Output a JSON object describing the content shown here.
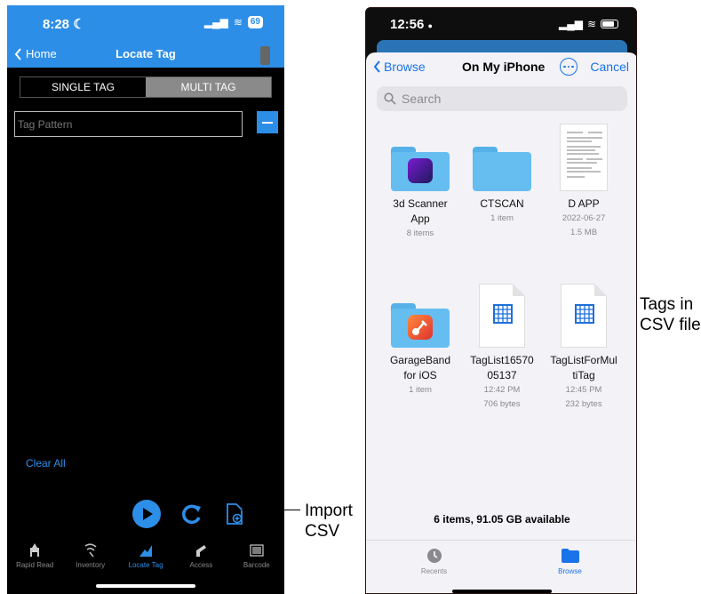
{
  "left_phone": {
    "status_bar": {
      "time": "8:28",
      "moon": "☾",
      "signal": "▂▄▆",
      "wifi": "≋",
      "battery": "69"
    },
    "nav": {
      "back_label": "Home",
      "title": "Locate Tag",
      "back_icon": "chevron-left-icon",
      "device_icon": "device-icon"
    },
    "segments": [
      {
        "label": "SINGLE TAG",
        "active": false
      },
      {
        "label": "MULTI TAG",
        "active": true
      }
    ],
    "tag_pattern_placeholder": "Tag Pattern",
    "clear_all": "Clear All",
    "actions": {
      "play_icon": "play-icon",
      "refresh_icon": "refresh-icon",
      "import_icon": "import-csv-icon"
    },
    "tabs": [
      {
        "label": "Rapid Read",
        "icon": "rapid-read-icon"
      },
      {
        "label": "Inventory",
        "icon": "inventory-icon"
      },
      {
        "label": "Locate Tag",
        "icon": "locate-tag-icon",
        "active": true
      },
      {
        "label": "Access",
        "icon": "access-icon"
      },
      {
        "label": "Barcode",
        "icon": "barcode-icon"
      }
    ]
  },
  "callouts": {
    "import_csv_line1": "Import",
    "import_csv_line2": "CSV",
    "tags_line1": "Tags in",
    "tags_line2": "CSV file"
  },
  "right_phone": {
    "status_bar": {
      "time": "12:56",
      "person": "●",
      "signal": "▂▄▆",
      "wifi": "≋"
    },
    "nav": {
      "browse": "Browse",
      "title": "On My iPhone",
      "cancel": "Cancel",
      "more_icon": "more-icon"
    },
    "search_placeholder": "Search",
    "files": [
      {
        "name_line1": "3d Scanner",
        "name_line2": "App",
        "meta1": "8 items",
        "meta2": "",
        "kind": "folder",
        "app_color": "#2b1f6b"
      },
      {
        "name_line1": "CTSCAN",
        "name_line2": "",
        "meta1": "1 item",
        "meta2": "",
        "kind": "folder"
      },
      {
        "name_line1": "D APP",
        "name_line2": "",
        "meta1": "2022-06-27",
        "meta2": "1.5 MB",
        "kind": "document"
      },
      {
        "name_line1": "GarageBand",
        "name_line2": "for iOS",
        "meta1": "1 item",
        "meta2": "",
        "kind": "folder",
        "app_color": "#f05a24"
      },
      {
        "name_line1": "TagList16570",
        "name_line2": "05137",
        "meta1": "12:42 PM",
        "meta2": "706 bytes",
        "kind": "csv"
      },
      {
        "name_line1": "TagListForMul",
        "name_line2": "tiTag",
        "meta1": "12:45 PM",
        "meta2": "232 bytes",
        "kind": "csv"
      }
    ],
    "summary": "6 items, 91.05 GB available",
    "tabs": [
      {
        "label": "Recents",
        "icon": "clock-icon"
      },
      {
        "label": "Browse",
        "icon": "folder-icon",
        "active": true
      }
    ]
  },
  "colors": {
    "accent_left": "#2d8ee8",
    "accent_right": "#1a73e8",
    "folder": "#65bdf0",
    "csv_grid": "#1e6fd9"
  }
}
